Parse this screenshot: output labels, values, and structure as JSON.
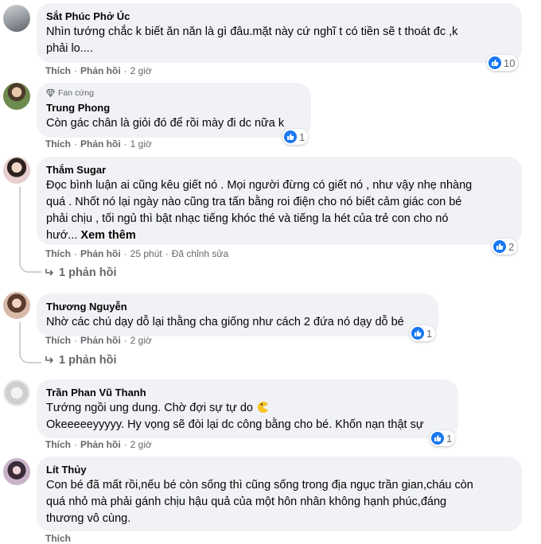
{
  "actions": {
    "like": "Thích",
    "reply": "Phản hồi",
    "dot": "·"
  },
  "comments": [
    {
      "author": "Sắt Phúc Phở Úc",
      "lines": [
        "Nhìn tướng chắc k biết ăn năn là gì đâu.mặt này cứ nghĩ t có tiền sẽ t thoát đc ,k",
        "phải lo...."
      ],
      "time": "2 giờ",
      "reactions": "10"
    },
    {
      "badge": "Fan cứng",
      "author": "Trung Phong",
      "lines": [
        "Còn gác chân là giỏi đó để rồi mày đi dc nữa k"
      ],
      "time": "1 giờ",
      "reactions": "1"
    },
    {
      "author": "Thắm Sugar",
      "lines": [
        "Đọc bình luận ai cũng kêu giết nó . Mọi người đừng có giết nó , như vậy nhẹ nhàng",
        "quá . Nhốt nó lại ngày nào cũng tra tấn bằng roi điện cho nó biết cảm giác con bé",
        "phải chịu , tối ngủ thì bật nhạc tiếng khóc thé và tiếng la hét của trẻ con cho nó",
        "hướ..."
      ],
      "see_more": "Xem thêm",
      "time": "25 phút",
      "edited": "Đã chỉnh sửa",
      "reactions": "2",
      "replies": "1 phản hồi"
    },
    {
      "author": "Thương Nguyễn",
      "lines": [
        "Nhờ các chú dạy dỗ lại thằng cha giống như cách 2 đứa nó dạy dỗ bé"
      ],
      "time": "2 giờ",
      "reactions": "1",
      "replies": "1 phản hồi"
    },
    {
      "author": "Trần Phan Vũ Thanh",
      "lines": [
        "Tướng ngồi ung dung. Chờ đợi sự tự do",
        "Okeeeeeyyyyy. Hy vọng sẽ đòi lại dc công bằng cho bé. Khốn nạn thật sự"
      ],
      "emoji": "pacman-emoji",
      "time": "2 giờ",
      "reactions": "1"
    },
    {
      "author": "Lít Thủy",
      "lines": [
        "Con bé đã mất rồi,nếu bé còn sống thì cũng sống trong địa ngục trần gian,cháu còn",
        "quá nhỏ mà phải gánh chịu hậu quả của một hôn nhân không hạnh phúc,đáng",
        "thương vô cùng."
      ],
      "time": ""
    }
  ],
  "colors": {
    "like_blue": "#1877f2",
    "bubble": "#f0f2f5",
    "meta": "#65676b"
  }
}
